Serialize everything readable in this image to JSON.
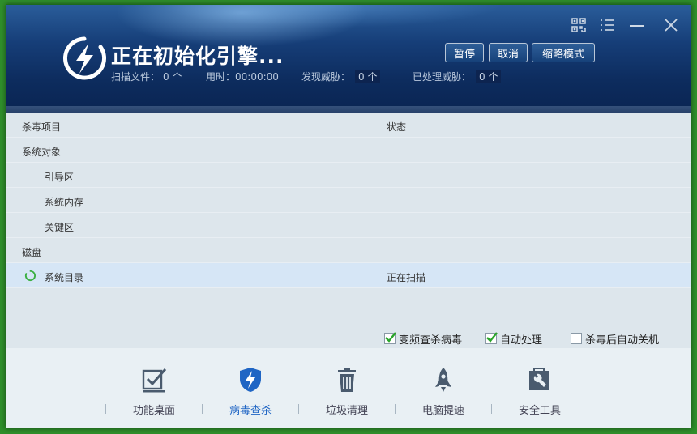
{
  "header": {
    "title": "正在初始化引擎...",
    "stats": {
      "scan_files_label": "扫描文件：",
      "scan_files_value": "0 个",
      "time_label": "用时：",
      "time_value": "00:00:00",
      "found_label": "发现威胁：",
      "found_value": "0 个",
      "handled_label": "已处理威胁：",
      "handled_value": "0 个"
    },
    "buttons": {
      "pause": "暂停",
      "cancel": "取消",
      "mini_mode": "缩略模式"
    }
  },
  "table": {
    "col_item": "杀毒项目",
    "col_status": "状态",
    "rows": [
      {
        "label": "系统对象",
        "status": ""
      },
      {
        "label": "引导区",
        "status": ""
      },
      {
        "label": "系统内存",
        "status": ""
      },
      {
        "label": "关键区",
        "status": ""
      },
      {
        "label": "磁盘",
        "status": ""
      },
      {
        "label": "系统目录",
        "status": "正在扫描"
      }
    ]
  },
  "options": {
    "freq": {
      "label": "变频查杀病毒",
      "checked": true
    },
    "auto": {
      "label": "自动处理",
      "checked": true
    },
    "shutdown": {
      "label": "杀毒后自动关机",
      "checked": false
    }
  },
  "nav": {
    "items": [
      {
        "label": "功能桌面",
        "icon": "checkbox-desktop-icon"
      },
      {
        "label": "病毒查杀",
        "icon": "shield-bolt-icon"
      },
      {
        "label": "垃圾清理",
        "icon": "trash-icon"
      },
      {
        "label": "电脑提速",
        "icon": "rocket-icon"
      },
      {
        "label": "安全工具",
        "icon": "toolbox-icon"
      }
    ]
  },
  "colors": {
    "accent": "#1f65c4",
    "check": "#2aa52a",
    "spinner": "#3cb043"
  }
}
